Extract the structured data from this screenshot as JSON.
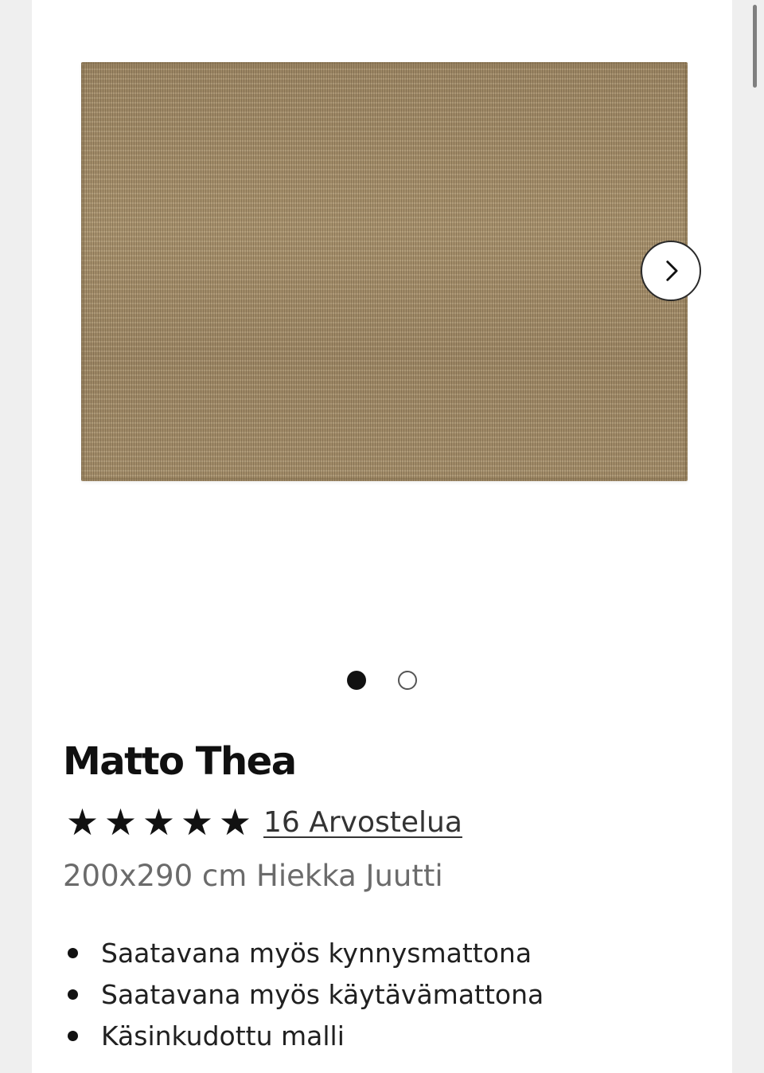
{
  "gallery": {
    "image_description": "Matto Thea",
    "next_icon": "chevron-right-icon",
    "slides_total": 2,
    "active_slide": 1
  },
  "product": {
    "title": "Matto Thea",
    "rating_stars": 5,
    "star_glyph": "★",
    "reviews_label": "16 Arvostelua",
    "variant": "200x290 cm Hiekka Juutti",
    "features": [
      "Saatavana myös kynnysmattona",
      "Saatavana myös käytävämattona",
      "Käsinkudottu malli"
    ]
  },
  "colors": {
    "text_primary": "#101010",
    "text_secondary": "#6b6b6b",
    "rug_tone": "#a08a68"
  }
}
